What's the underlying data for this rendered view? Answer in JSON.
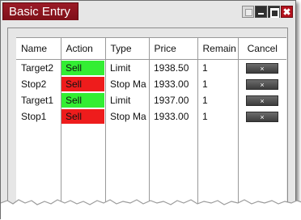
{
  "window": {
    "title": "Basic Entry"
  },
  "table": {
    "columns": [
      "Name",
      "Action",
      "Type",
      "Price",
      "Remain",
      "Cancel"
    ],
    "rows": [
      {
        "name": "Target2",
        "action": "Sell",
        "action_color": "#33ee33",
        "type": "Limit",
        "price": "1938.50",
        "remain": "1",
        "cancel": "×"
      },
      {
        "name": "Stop2",
        "action": "Sell",
        "action_color": "#ee1c1c",
        "type": "Stop Ma",
        "price": "1933.00",
        "remain": "1",
        "cancel": "×"
      },
      {
        "name": "Target1",
        "action": "Sell",
        "action_color": "#33ee33",
        "type": "Limit",
        "price": "1937.00",
        "remain": "1",
        "cancel": "×"
      },
      {
        "name": "Stop1",
        "action": "Sell",
        "action_color": "#ee1c1c",
        "type": "Stop Ma",
        "price": "1933.00",
        "remain": "1",
        "cancel": "×"
      }
    ]
  },
  "colors": {
    "title_bar": "#8b1520",
    "buy_green": "#33ee33",
    "stop_red": "#ee1c1c"
  },
  "icons": {
    "restore": "restore-icon",
    "minimize": "minimize-icon",
    "maximize": "maximize-icon",
    "close": "close-icon"
  }
}
